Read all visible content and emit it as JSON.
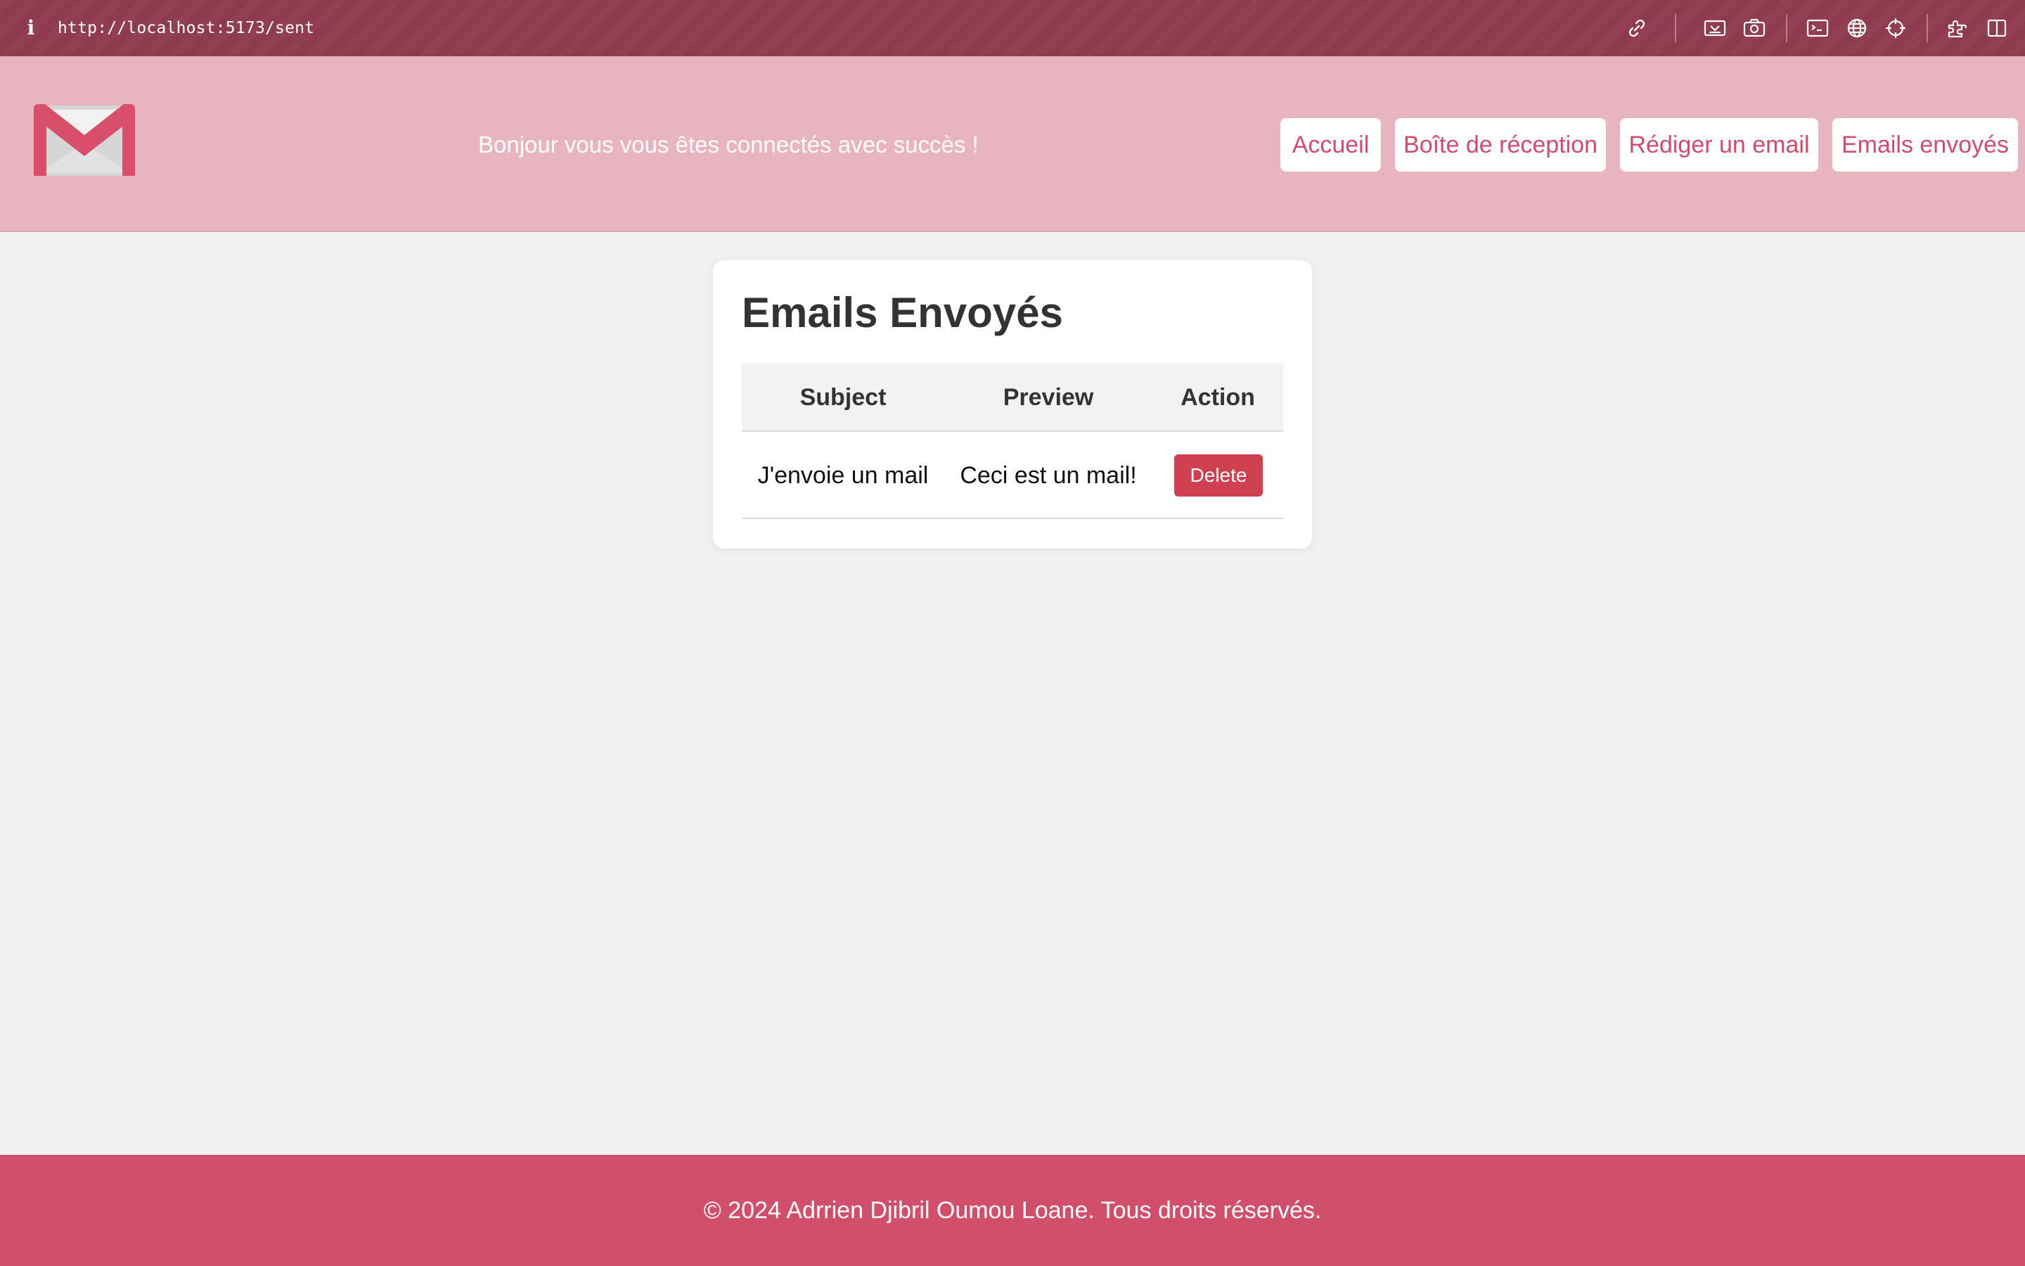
{
  "browser": {
    "url": "http://localhost:5173/sent",
    "icons": [
      "info-icon",
      "link-icon",
      "screenshot-icon",
      "camera-icon",
      "terminal-icon",
      "globe-icon",
      "crosshair-icon",
      "extensions-icon",
      "split-view-icon"
    ]
  },
  "header": {
    "welcome": "Bonjour vous vous êtes connectés avec succès !",
    "nav": [
      "Accueil",
      "Boîte de réception",
      "Rédiger un email",
      "Emails envoyés"
    ]
  },
  "main": {
    "title": "Emails Envoyés",
    "columns": [
      "Subject",
      "Preview",
      "Action"
    ],
    "rows": [
      {
        "subject": "J'envoie un mail",
        "preview": "Ceci est un mail!",
        "action": "Delete"
      }
    ]
  },
  "footer": {
    "text": "© 2024 Adrrien Djibril Oumou Loane. Tous droits réservés."
  },
  "colors": {
    "accent": "#d14f6b",
    "header_bg": "#e8b4bf",
    "delete": "#cf4050"
  }
}
